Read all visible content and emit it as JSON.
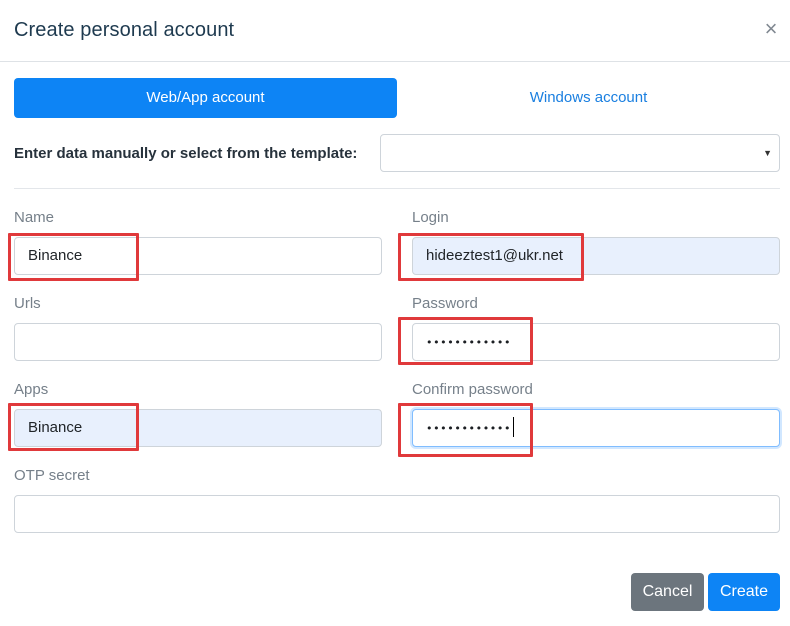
{
  "dialog": {
    "title": "Create personal account",
    "close_glyph": "×"
  },
  "tabs": {
    "web_app": "Web/App account",
    "windows": "Windows account",
    "active": "web_app"
  },
  "template": {
    "label": "Enter data manually or select from the template:",
    "selected_value": ""
  },
  "fields": {
    "name": {
      "label": "Name",
      "value": "Binance"
    },
    "login": {
      "label": "Login",
      "value": "hideeztest1@ukr.net"
    },
    "urls": {
      "label": "Urls",
      "value": ""
    },
    "password": {
      "label": "Password",
      "value": "••••••••••••"
    },
    "apps": {
      "label": "Apps",
      "value": "Binance"
    },
    "confirm_password": {
      "label": "Confirm password",
      "value": "••••••••••••"
    },
    "otp_secret": {
      "label": "OTP secret",
      "value": ""
    }
  },
  "buttons": {
    "cancel": "Cancel",
    "create": "Create"
  },
  "colors": {
    "primary": "#0d84f5",
    "secondary": "#6c757d",
    "highlight": "#e0393b",
    "autofill": "#e8f0fd"
  }
}
